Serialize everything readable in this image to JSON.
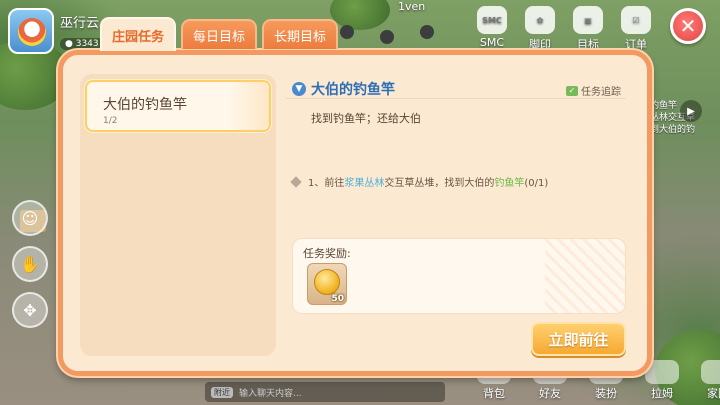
{
  "hud": {
    "player_name": "巫行云",
    "coin_count": "3343",
    "top_center": "1ven",
    "top_icons": [
      {
        "label": "SMC",
        "icon": "smc-badge-icon"
      },
      {
        "label": "脚印",
        "icon": "paw-print-icon"
      },
      {
        "label": "目标",
        "icon": "target-card-icon"
      },
      {
        "label": "订单",
        "icon": "order-list-icon"
      }
    ],
    "right_side_text": [
      "钓鱼竿",
      "丛林交互草",
      "到大伯的钓"
    ],
    "right_side_highlight": "钓",
    "bottom_items": [
      "背包",
      "好友",
      "装扮",
      "拉姆",
      "家园"
    ],
    "chat_tag": "附近",
    "chat_placeholder": "输入聊天内容..."
  },
  "dialog": {
    "tabs": [
      {
        "label": "庄园任务",
        "active": true
      },
      {
        "label": "每日目标",
        "active": false
      },
      {
        "label": "长期目标",
        "active": false
      }
    ],
    "task_list": [
      {
        "title": "大伯的钓鱼竿",
        "progress": "1/2",
        "selected": true
      }
    ],
    "detail": {
      "title": "大伯的钓鱼竿",
      "track_label": "任务追踪",
      "description": "找到钓鱼竿；还给大伯",
      "step": {
        "prefix": "1、前往",
        "location": "浆果丛林",
        "middle": "交互草丛堆，找到大伯的",
        "item": "钓鱼竿",
        "progress": "(0/1)"
      },
      "reward_title": "任务奖励:",
      "rewards": [
        {
          "icon": "gold-coin-icon",
          "quantity": "50"
        }
      ],
      "go_button": "立即前往"
    }
  },
  "colors": {
    "frame": "#f39a63",
    "panel": "#fbe9d2",
    "title_blue": "#2d6eb4",
    "location_blue": "#4eb0d6",
    "item_green": "#6ab944",
    "button_gold": "#f5a932",
    "close_red": "#e24545"
  }
}
